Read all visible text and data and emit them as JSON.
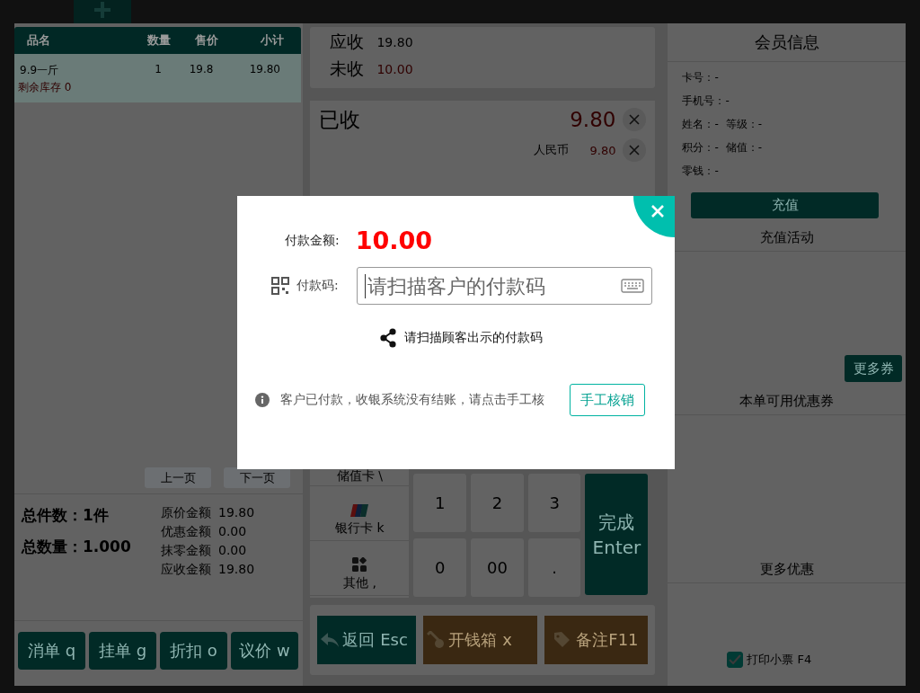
{
  "order_table": {
    "columns": [
      "品名",
      "数量",
      "售价",
      "小计"
    ],
    "rows": [
      {
        "name": "9.9一斤",
        "qty": "1",
        "price": "19.8",
        "subtotal": "19.80",
        "stock_note": "剩余库存 0",
        "selected": true
      }
    ],
    "pagination": [
      "上一页",
      "下一页"
    ]
  },
  "totals": {
    "counts": [
      {
        "label": "总件数：",
        "value": "1件"
      },
      {
        "label": "总数量：",
        "value": "1.000"
      }
    ],
    "amounts": [
      {
        "label": "原价金额",
        "value": "19.80"
      },
      {
        "label": "优惠金额",
        "value": "0.00"
      },
      {
        "label": "抹零金额",
        "value": "0.00"
      },
      {
        "label": "应收金额",
        "value": "19.80"
      }
    ]
  },
  "order_actions": [
    "消单 q",
    "挂单 g",
    "折扣 o",
    "议价 w"
  ],
  "payment_summary": [
    {
      "label": "应收",
      "value": "19.80",
      "kind": "normal"
    },
    {
      "label": "未收",
      "value": "10.00",
      "kind": "due"
    }
  ],
  "received": {
    "label": "已收",
    "value": "9.80",
    "payments": [
      {
        "method": "人民币",
        "amount": "9.80"
      }
    ]
  },
  "payment_methods": [
    {
      "label": "储值卡 \\",
      "kind": "plain"
    },
    {
      "label": "银行卡 k",
      "kind": "card"
    },
    {
      "label": "其他 ,",
      "kind": "apps"
    }
  ],
  "keypad": {
    "keys": [
      "1",
      "2",
      "3",
      "0",
      "00",
      "."
    ],
    "confirm": "完成 Enter"
  },
  "bottom_actions": [
    {
      "label": "返回 Esc",
      "kind": "back"
    },
    {
      "label": "开钱箱 x",
      "kind": "cashbox"
    },
    {
      "label": "备注F11",
      "kind": "note"
    }
  ],
  "member": {
    "title": "会员信息",
    "fields": [
      [
        "卡号：-"
      ],
      [
        "手机号：-"
      ],
      [
        "姓名：-",
        "等级：-"
      ],
      [
        "积分：-",
        "储值：-"
      ],
      [
        "零钱：-"
      ]
    ],
    "recharge_button": "充值"
  },
  "recharge_activity": {
    "title": "充值活动",
    "more_button": "更多券"
  },
  "coupons": {
    "title": "本单可用优惠券"
  },
  "more_offers": {
    "title": "更多优惠"
  },
  "print_receipt": {
    "label": "打印小票 F4",
    "checked": true
  },
  "payment_dialog": {
    "amount_label": "付款金额:",
    "amount": "10.00",
    "code_label": "付款码:",
    "code_placeholder": "请扫描客户的付款码",
    "hint": "请扫描顾客出示的付款码",
    "notice": "客户已付款，收银系统没有结账，请点击手工核",
    "manual_button": "手工核销"
  }
}
